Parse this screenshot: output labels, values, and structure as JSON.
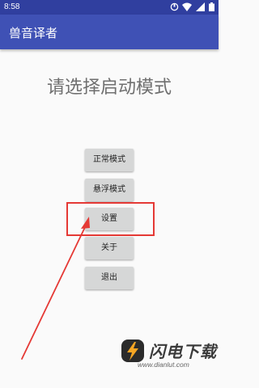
{
  "status_bar": {
    "time": "8:58",
    "icons": [
      "sync-icon",
      "wifi-icon",
      "signal-icon",
      "battery-icon"
    ]
  },
  "app_bar": {
    "title": "兽音译者",
    "color": "#3F51B5",
    "status_color": "#303F9F"
  },
  "main": {
    "prompt": "请选择启动模式",
    "buttons": [
      {
        "label": "正常模式"
      },
      {
        "label": "悬浮模式"
      },
      {
        "label": "设置"
      },
      {
        "label": "关于"
      },
      {
        "label": "退出"
      }
    ]
  },
  "annotation": {
    "highlight_color": "#e53935"
  },
  "watermark": {
    "name": "闪电下载",
    "url": "www.dianlut.com"
  }
}
